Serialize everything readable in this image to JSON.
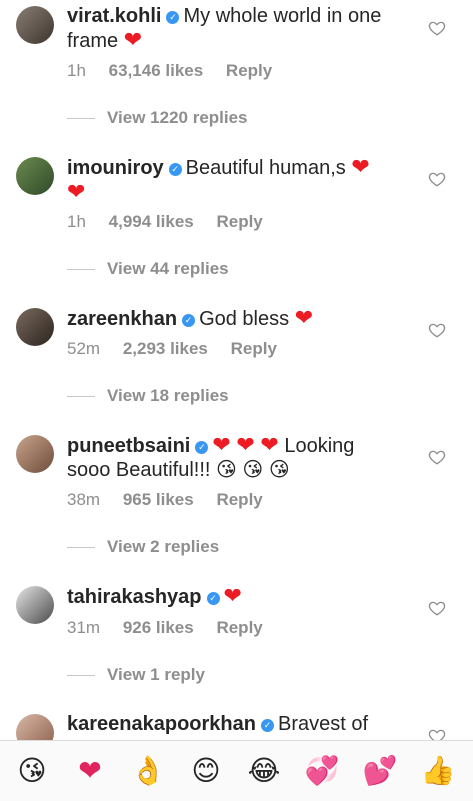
{
  "comments": [
    {
      "username": "virat.kohli",
      "text_line1": "My whole world in one",
      "text_line2": "frame",
      "time": "1h",
      "likes": "63,146 likes",
      "reply": "Reply",
      "view_replies": "View 1220 replies"
    },
    {
      "username": "imouniroy",
      "text_line1": "Beautiful human,s",
      "time": "1h",
      "likes": "4,994 likes",
      "reply": "Reply",
      "view_replies": "View 44 replies"
    },
    {
      "username": "zareenkhan",
      "text_line1": "God bless",
      "time": "52m",
      "likes": "2,293 likes",
      "reply": "Reply",
      "view_replies": "View 18 replies"
    },
    {
      "username": "puneetbsaini",
      "text_line1": "Looking",
      "text_line2": "sooo Beautiful!!!",
      "time": "38m",
      "likes": "965 likes",
      "reply": "Reply",
      "view_replies": "View 2 replies"
    },
    {
      "username": "tahirakashyap",
      "time": "31m",
      "likes": "926 likes",
      "reply": "Reply",
      "view_replies": "View 1 reply"
    },
    {
      "username": "kareenakapoorkhan",
      "text_line1": "Bravest of"
    }
  ],
  "emoji_bar": [
    "kissing-face",
    "red-heart",
    "ok-hand",
    "smiling-face",
    "tears-of-joy",
    "revolving-hearts",
    "two-hearts",
    "thumbs-up"
  ],
  "colors": {
    "text": "#262626",
    "meta": "#8e8e8e",
    "verified": "#3897f0",
    "heart": "#ed1c24"
  }
}
